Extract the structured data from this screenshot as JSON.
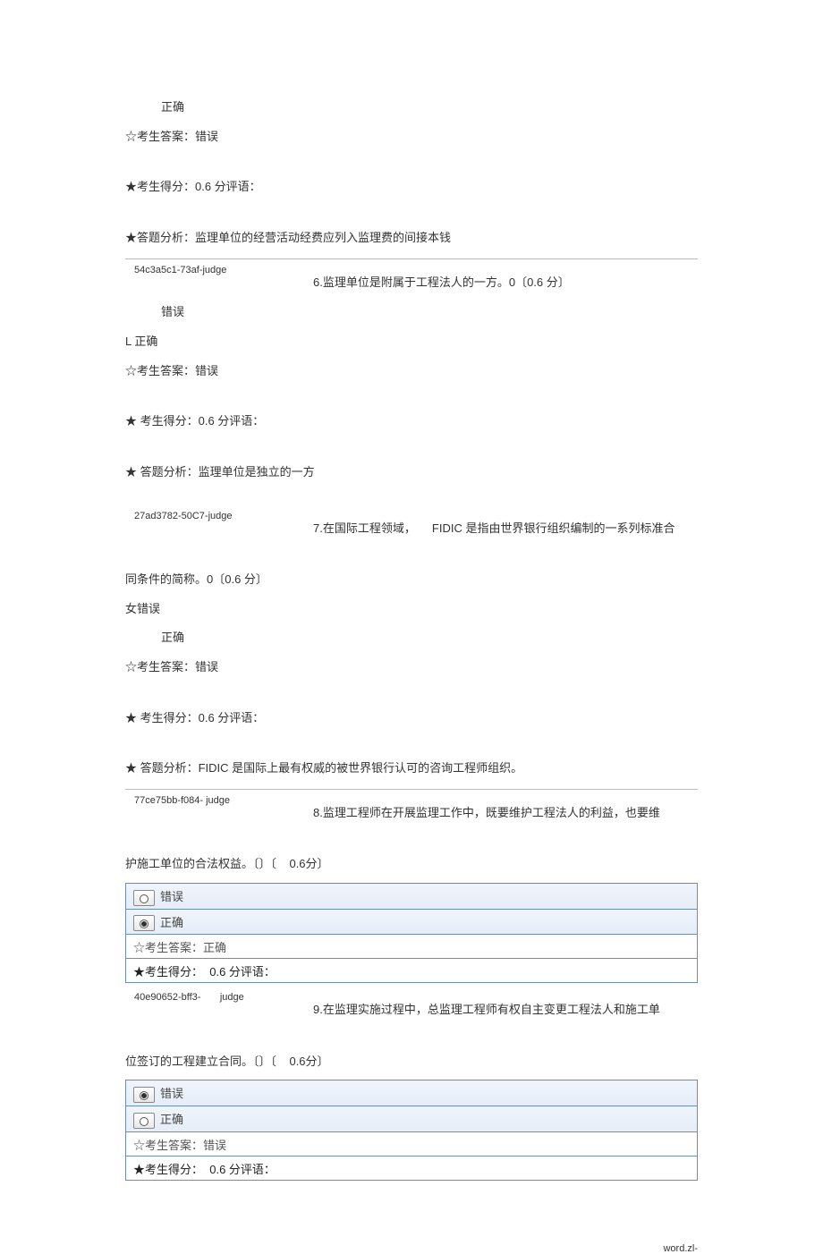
{
  "q5": {
    "opt_correct": "正确",
    "stu_ans": "☆考生答案：错误",
    "score": "★考生得分：0.6 分评语：",
    "analysis": "★答题分析：监理单位的经营活动经费应列入监理费的间接本钱"
  },
  "q6": {
    "code": "54c3a5c1-73af-judge",
    "text": "6.监理单位是附属于工程法人的一方。0〔0.6 分〕",
    "opt_wrong": "错误",
    "opt_correct": "L 正确",
    "stu_ans": "☆考生答案：错误",
    "score": "★  考生得分：0.6 分评语：",
    "analysis": "★  答题分析：监理单位是独立的一方"
  },
  "q7": {
    "code": "27ad3782-50C7-judge",
    "text_a": "7.在国际工程领域，",
    "text_b": "FIDIC 是指由世界银行组织编制的一系列标准合",
    "text_c": "同条件的简称。0〔0.6 分〕",
    "opt_wrong": "女错误",
    "opt_correct": "正确",
    "stu_ans": "☆考生答案：错误",
    "score": "★  考生得分：0.6 分评语：",
    "analysis": "★  答题分析：FIDIC 是国际上最有权威的被世界银行认可的咨询工程师组织。"
  },
  "q8": {
    "code": "77ce75bb-f084- judge",
    "text_a": "8.监理工程师在开展监理工作中，既要维护工程法人的利益，也要维",
    "text_b": "护施工单位的合法权益。〔〕〔",
    "points": "0.6分〕",
    "opt_wrong": "错误",
    "opt_correct": "正确",
    "stu_ans": "☆考生答案：正确",
    "score_a": "★考生得分：",
    "score_b": "0.6 分评语："
  },
  "q9": {
    "code_a": "40e90652-bff3-",
    "code_b": "judge",
    "text_a": "9.在监理实施过程中，总监理工程师有权自主变更工程法人和施工单",
    "text_b": "位签订的工程建立合同。〔〕〔",
    "points": "0.6分〕",
    "opt_wrong": "错误",
    "opt_correct": "正确",
    "stu_ans": "☆考生答案：错误",
    "score_a": "★考生得分：",
    "score_b": "0.6 分评语："
  },
  "footer": "word.zl-"
}
